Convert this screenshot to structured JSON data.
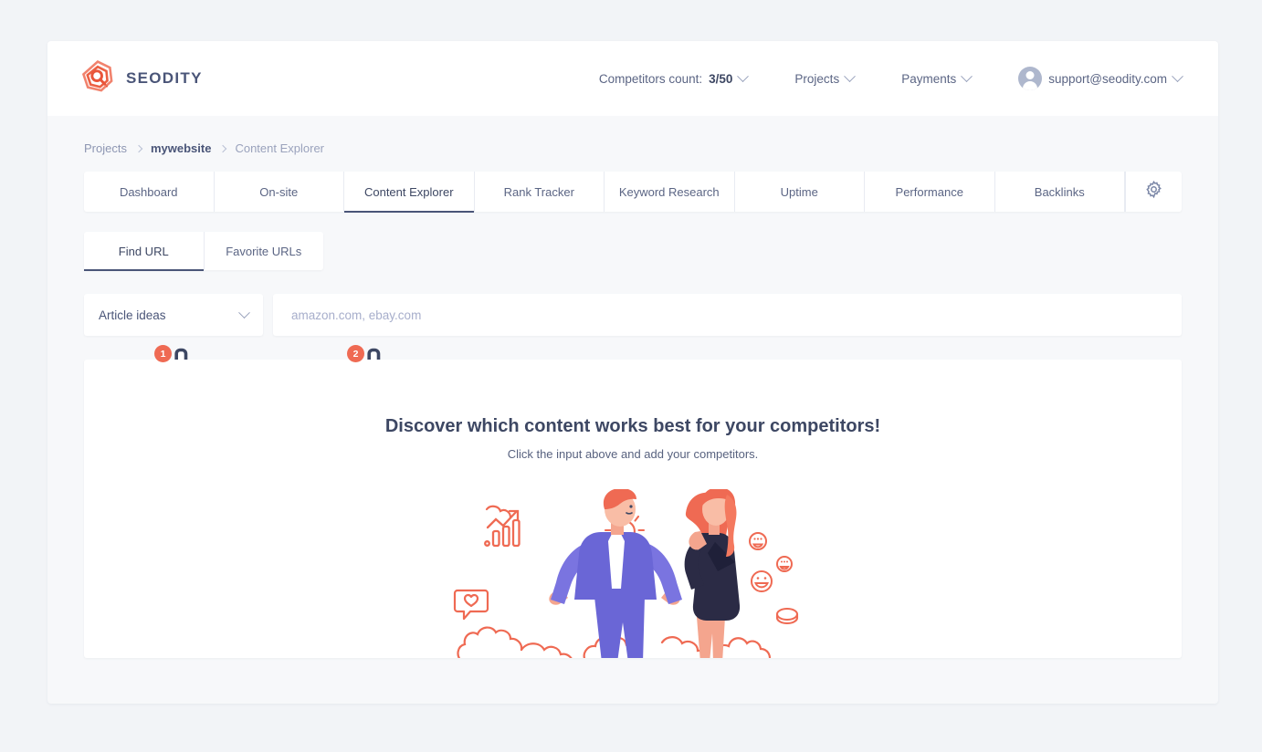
{
  "brand": {
    "name": "SEODITY",
    "logo_icon": "seodity-hex-magnifier-logo",
    "color": "#ef6a53"
  },
  "header": {
    "competitors_label": "Competitors count:",
    "competitors_value": "3/50",
    "projects_label": "Projects",
    "payments_label": "Payments",
    "account_email": "support@seodity.com",
    "avatar_icon": "user-avatar-icon",
    "caret_icon": "chevron-down-icon"
  },
  "breadcrumb": {
    "items": [
      {
        "label": "Projects"
      },
      {
        "label": "mywebsite"
      },
      {
        "label": "Content Explorer"
      }
    ],
    "separator_icon": "chevron-right-icon"
  },
  "tabs": {
    "items": [
      {
        "label": "Dashboard",
        "active": false
      },
      {
        "label": "On-site",
        "active": false
      },
      {
        "label": "Content Explorer",
        "active": true
      },
      {
        "label": "Rank Tracker",
        "active": false
      },
      {
        "label": "Keyword Research",
        "active": false
      },
      {
        "label": "Uptime",
        "active": false
      },
      {
        "label": "Performance",
        "active": false
      },
      {
        "label": "Backlinks",
        "active": false
      }
    ],
    "settings_icon": "gear-icon"
  },
  "subtabs": {
    "items": [
      {
        "label": "Find URL",
        "active": true
      },
      {
        "label": "Favorite URLs",
        "active": false
      }
    ]
  },
  "search": {
    "mode_value": "Article ideas",
    "mode_caret_icon": "chevron-down-icon",
    "url_value": "",
    "url_placeholder": "amazon.com, ebay.com"
  },
  "annotations": [
    {
      "badge": "1",
      "icon": "pointing-hand-cursor-icon"
    },
    {
      "badge": "2",
      "icon": "pointing-hand-cursor-icon"
    }
  ],
  "empty_state": {
    "title": "Discover which content works best for your competitors!",
    "subtitle": "Click the input above and add your competitors.",
    "illustration_icon": "two-people-competitors-illustration"
  },
  "colors": {
    "accent_orange": "#ef6a53",
    "ink_blue": "#3d4763",
    "muted": "#8d96b2",
    "page_bg": "#f2f4f7",
    "purple": "#6a66d6"
  }
}
